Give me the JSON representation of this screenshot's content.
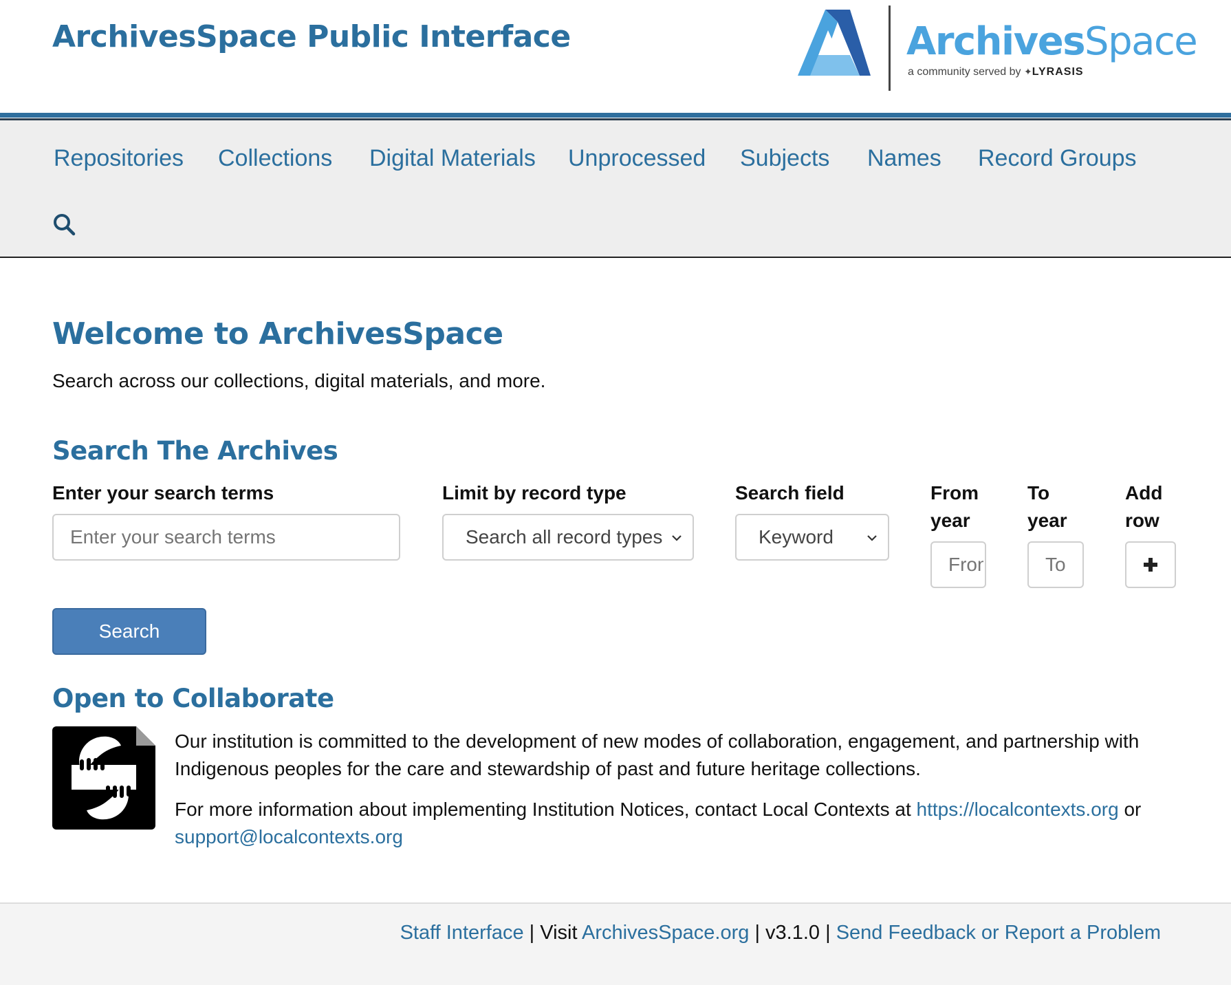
{
  "header": {
    "site_title": "ArchivesSpace Public Interface",
    "logo": {
      "word_bold": "Archives",
      "word_light": "Space",
      "tagline": "a community served by",
      "tagline_brand": "LYRASIS"
    }
  },
  "nav": {
    "items": [
      {
        "label": "Repositories"
      },
      {
        "label": "Collections"
      },
      {
        "label": "Digital Materials"
      },
      {
        "label": "Unprocessed"
      },
      {
        "label": "Subjects"
      },
      {
        "label": "Names"
      },
      {
        "label": "Record Groups"
      }
    ],
    "search_icon": "search-icon"
  },
  "main": {
    "welcome_title": "Welcome to ArchivesSpace",
    "welcome_text": "Search across our collections, digital materials, and more.",
    "search": {
      "title": "Search The Archives",
      "terms_label": "Enter your search terms",
      "terms_placeholder": "Enter your search terms",
      "record_type_label": "Limit by record type",
      "record_type_value": "Search all record types",
      "field_label": "Search field",
      "field_value": "Keyword",
      "from_label_1": "From",
      "from_label_2": "year",
      "from_placeholder": "From",
      "to_label_1": "To",
      "to_label_2": "year",
      "to_placeholder": "To",
      "add_label_1": "Add",
      "add_label_2": "row",
      "add_icon": "plus-icon",
      "button_label": "Search"
    },
    "collaborate": {
      "title": "Open to Collaborate",
      "icon": "institution-notice-icon",
      "paragraph_1": "Our institution is committed to the development of new modes of collaboration, engagement, and partnership with Indigenous peoples for the care and stewardship of past and future heritage collections.",
      "paragraph_2_prefix": "For more information about implementing Institution Notices, contact Local Contexts at ",
      "link_1": "https://localcontexts.org",
      "paragraph_2_middle": " or ",
      "link_2": "support@localcontexts.org"
    }
  },
  "footer": {
    "staff_link": "Staff Interface",
    "sep_1": " | Visit ",
    "site_link": "ArchivesSpace.org",
    "sep_2": " | v3.1.0 | ",
    "feedback_link": "Send Feedback or Report a Problem"
  },
  "colors": {
    "brand_blue": "#2b6f9e",
    "button_blue": "#4a7fb9",
    "nav_bg": "#eeeeee",
    "logo_light_blue": "#4aa3de"
  }
}
